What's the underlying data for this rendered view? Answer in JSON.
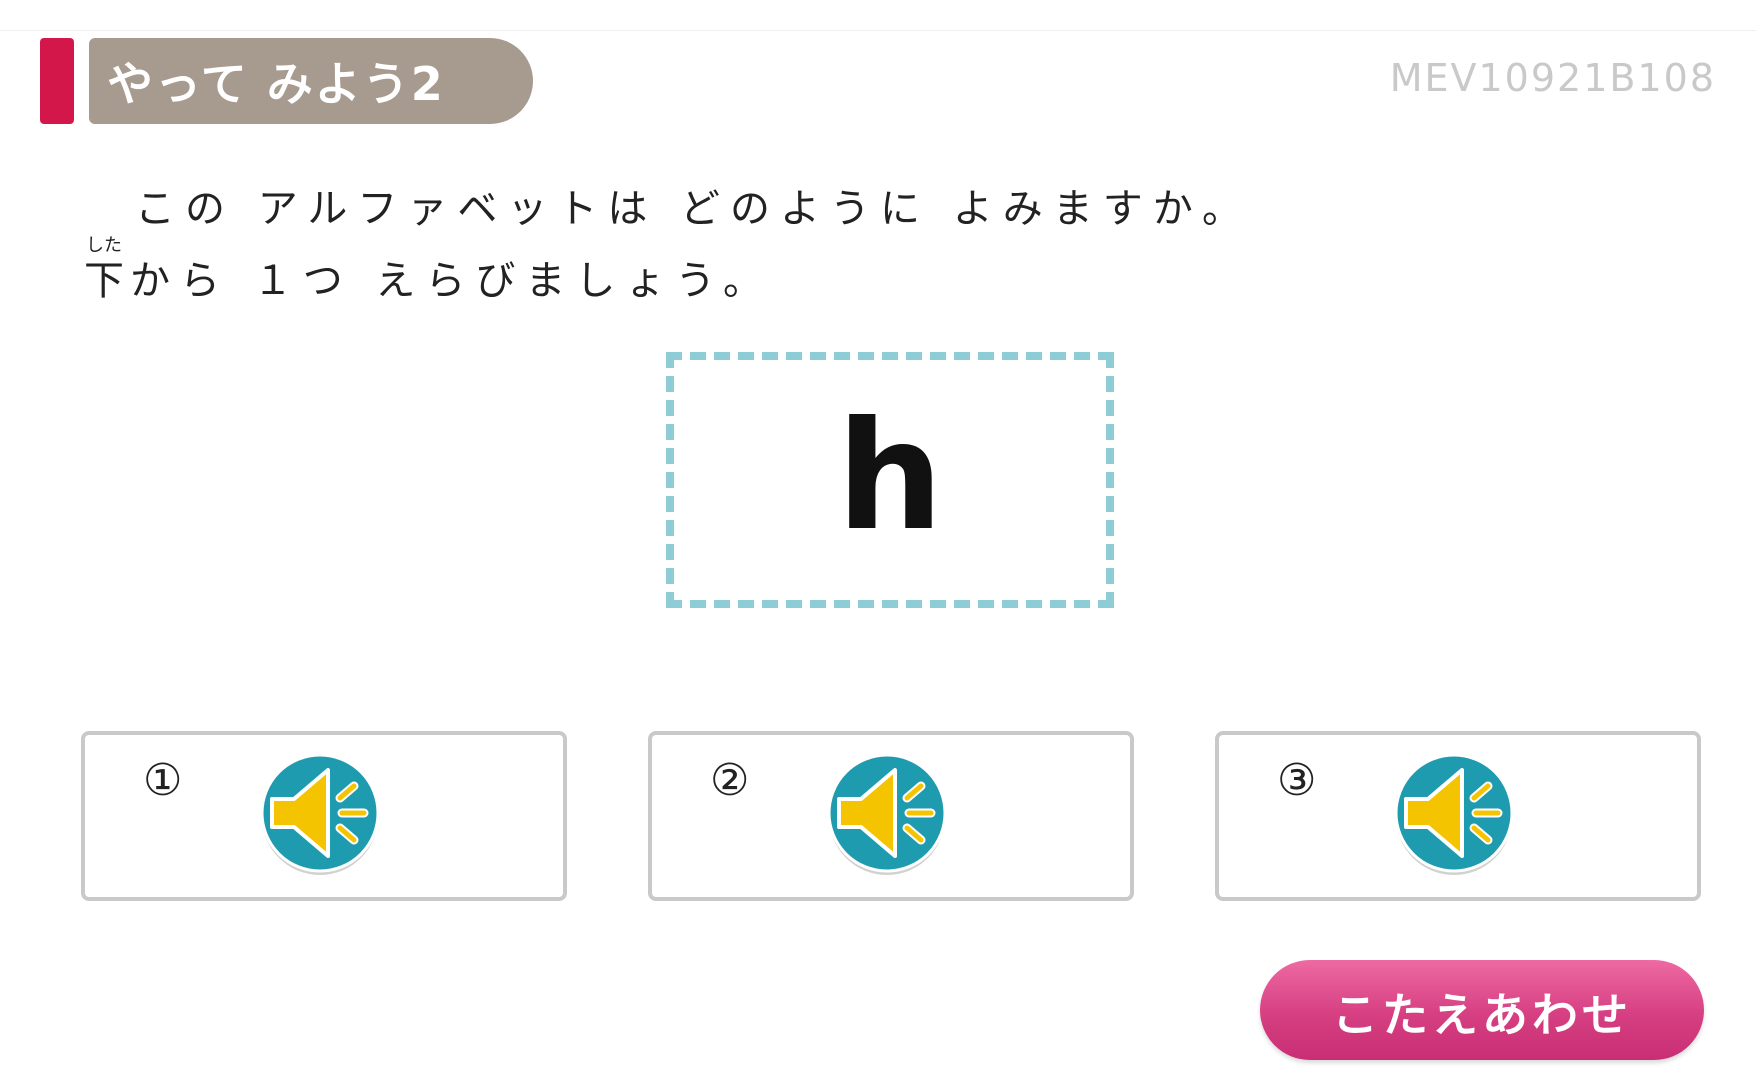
{
  "header": {
    "title": "やって みよう2",
    "code": "MEV10921B108"
  },
  "question": {
    "line1": "この アルファベットは どのように よみますか。",
    "line2_ruby_base": "下",
    "line2_ruby_reading": "した",
    "line2_rest": "から １つ えらびましょう。"
  },
  "letter": "h",
  "options": [
    {
      "number": "①",
      "icon": "speaker-icon"
    },
    {
      "number": "②",
      "icon": "speaker-icon"
    },
    {
      "number": "③",
      "icon": "speaker-icon"
    }
  ],
  "answer_button": {
    "label": "こたえあわせ"
  },
  "colors": {
    "accent": "#d4174a",
    "title_bg": "#a79a8f",
    "dashed_border": "#8ecdd6",
    "speaker_circle": "#1f9bb0",
    "speaker_fill": "#f5c400",
    "button_pink": "#d63f82"
  }
}
